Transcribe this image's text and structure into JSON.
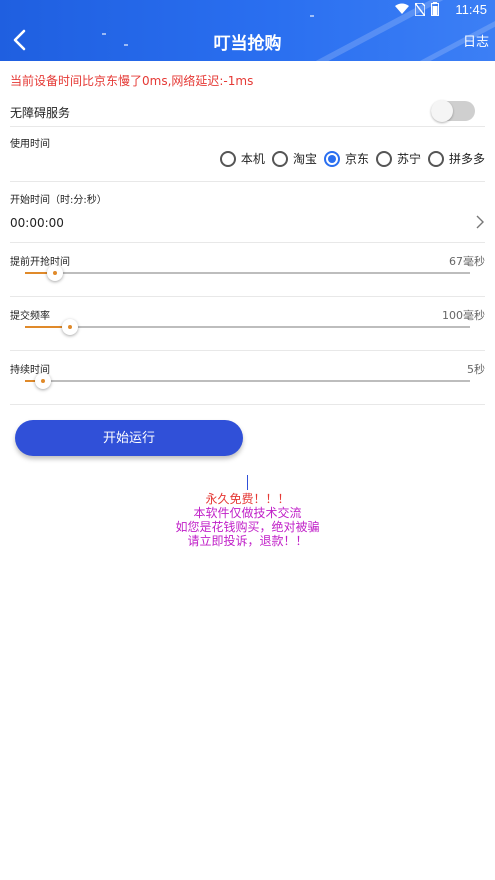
{
  "status_bar": {
    "time": "11:45"
  },
  "header": {
    "title": "叮当抢购",
    "log_label": "日志"
  },
  "time_diff_text": "当前设备时间比京东慢了0ms,网络延迟:-1ms",
  "accessibility": {
    "label": "无障碍服务",
    "enabled": false
  },
  "platform": {
    "label": "使用时间",
    "options": [
      "本机",
      "淘宝",
      "京东",
      "苏宁",
      "拼多多"
    ],
    "selected": "京东"
  },
  "start_time": {
    "label": "开始时间（时:分:秒）",
    "value": "00:00:00"
  },
  "sliders": [
    {
      "label": "提前开抢时间",
      "value_text": "67毫秒",
      "fraction": 0.067
    },
    {
      "label": "提交频率",
      "value_text": "100毫秒",
      "fraction": 0.1
    },
    {
      "label": "持续时间",
      "value_text": "5秒",
      "fraction": 0.04
    }
  ],
  "run_button_label": "开始运行",
  "notice": {
    "line1": "永久免费！！！",
    "line2": "本软件仅做技术交流",
    "line3": "如您是花钱购买，绝对被骗",
    "line4": "请立即投诉，退款！！"
  },
  "colors": {
    "accent": "#2a6ff0",
    "button": "#3050d8",
    "warning": "#e53935",
    "notice": "#c020c8",
    "slider_fill": "#e08a2a"
  }
}
